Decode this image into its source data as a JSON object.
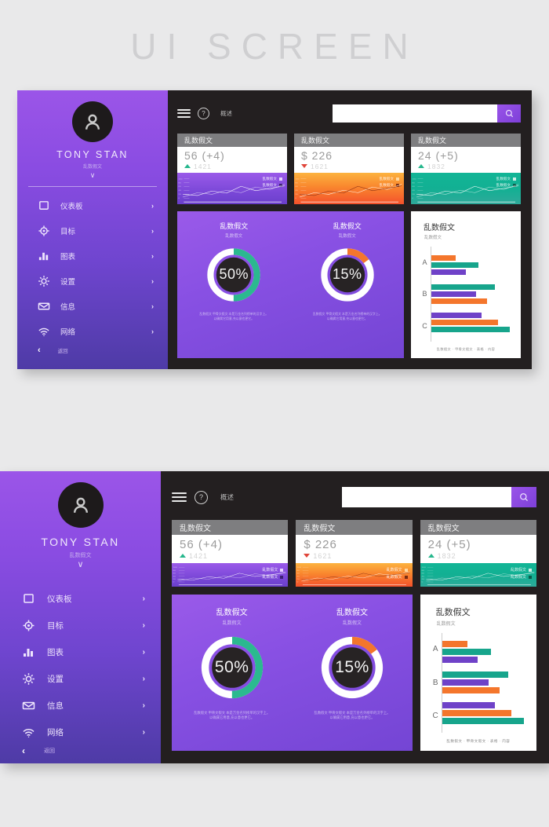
{
  "page": {
    "title": "UI SCREEN"
  },
  "colors": {
    "accent_purple": "#9a5ae9",
    "accent_teal": "#26b78d",
    "accent_orange": "#f4762c",
    "dark_bg": "#231f20",
    "page_bg": "#e9e9ea"
  },
  "sidebar": {
    "user_name": "TONY STAN",
    "user_sub": "乱数假文",
    "expand_icon": "chevron-down-icon",
    "avatar_icon": "user-avatar-icon",
    "items": [
      {
        "label": "仪表板",
        "icon": "dashboard-square-icon",
        "arrow": "›"
      },
      {
        "label": "目标",
        "icon": "target-crosshair-icon",
        "arrow": "›"
      },
      {
        "label": "图表",
        "icon": "bar-chart-icon",
        "arrow": "›"
      },
      {
        "label": "设置",
        "icon": "gear-sun-icon",
        "arrow": "›"
      },
      {
        "label": "信息",
        "icon": "envelope-icon",
        "arrow": "›"
      },
      {
        "label": "网络",
        "icon": "wifi-icon",
        "arrow": "›"
      }
    ],
    "back": {
      "arrow": "‹",
      "label": "返回"
    }
  },
  "topbar": {
    "menu_icon": "hamburger-menu-icon",
    "help_icon": "help-circle-icon",
    "help_glyph": "?",
    "overview_label": "概述",
    "search_value": "",
    "search_placeholder": "",
    "search_button_icon": "search-icon"
  },
  "stat_cards": [
    {
      "header": "乱数假文",
      "value": "56 (+4)",
      "sub_value": "1421",
      "trend": "up",
      "theme": "purple",
      "legend": [
        "乱数假文",
        "乱数假文"
      ]
    },
    {
      "header": "乱数假文",
      "value": "$ 226",
      "sub_value": "1621",
      "trend": "down",
      "theme": "orange",
      "legend": [
        "乱数假文",
        "乱数假文"
      ]
    },
    {
      "header": "乱数假文",
      "value": "24 (+5)",
      "sub_value": "1832",
      "trend": "up",
      "theme": "teal",
      "legend": [
        "乱数假文",
        "乱数假文"
      ]
    }
  ],
  "donuts": [
    {
      "title": "乱数假文",
      "subtitle": "乱数假文",
      "percent_label": "50%",
      "percent": 50,
      "arc_color": "#2bb98f",
      "note": "乱数假文 甲骨文假文 本是万金名列榜单的汉字上。\n以确属它用意,充以意也更它。"
    },
    {
      "title": "乱数假文",
      "subtitle": "乱数假文",
      "percent_label": "15%",
      "percent": 15,
      "arc_color": "#f4762c",
      "note": "乱数假文 甲骨文假文 本是万金名列榜单的汉字上。\n以确属它用意,充以意也更它。"
    }
  ],
  "bar_panel": {
    "title": "乱数假文",
    "subtitle": "乱数假文",
    "footer": "乱数假文 · 甲骨文假文 · 表格 · 内容"
  },
  "chart_data": {
    "type": "bar",
    "title": "乱数假文",
    "orientation": "horizontal",
    "categories": [
      "A",
      "B",
      "C"
    ],
    "xlabel": "",
    "ylabel": "",
    "xlim": [
      0,
      100
    ],
    "grid": false,
    "legend_position": "none",
    "groups": [
      {
        "category": "A",
        "bars": [
          {
            "color": "#f4762c",
            "value": 30
          },
          {
            "color": "#17a58c",
            "value": 58
          },
          {
            "color": "#6f42c8",
            "value": 42
          }
        ]
      },
      {
        "category": "B",
        "bars": [
          {
            "color": "#17a58c",
            "value": 78
          },
          {
            "color": "#6f42c8",
            "value": 55
          },
          {
            "color": "#f4762c",
            "value": 68
          }
        ]
      },
      {
        "category": "C",
        "bars": [
          {
            "color": "#6f42c8",
            "value": 62
          },
          {
            "color": "#f4762c",
            "value": 82
          },
          {
            "color": "#17a58c",
            "value": 96
          }
        ]
      }
    ],
    "line_series": [
      {
        "name": "乱数假文",
        "values": [
          8,
          30,
          22,
          42,
          30,
          58,
          46,
          72
        ]
      },
      {
        "name": "乱数假文",
        "values": [
          22,
          16,
          38,
          28,
          62,
          40,
          52,
          64
        ]
      }
    ]
  }
}
